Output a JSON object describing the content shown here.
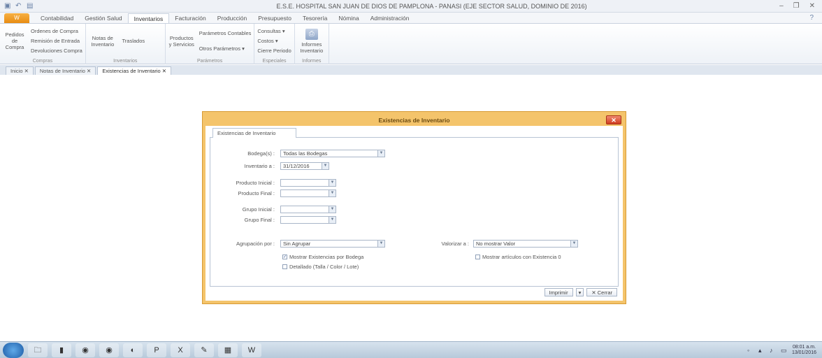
{
  "window": {
    "title": "E.S.E. HOSPITAL SAN JUAN DE DIOS DE PAMPLONA - PANASI (EJE SECTOR SALUD, DOMINIO DE 2016)",
    "qa_icons": [
      "save-icon",
      "undo-icon",
      "app-icon"
    ]
  },
  "ribbon": {
    "app_button": "W",
    "tabs": [
      "Contabilidad",
      "Gestión Salud",
      "Inventarios",
      "Facturación",
      "Producción",
      "Presupuesto",
      "Tesorería",
      "Nómina",
      "Administración"
    ],
    "active_tab": "Inventarios",
    "groups": {
      "compras": {
        "label": "Compras",
        "big": "Pedidos de Compra",
        "items": [
          "Ordenes de Compra",
          "Remisión de Entrada",
          "Devoluciones Compra"
        ]
      },
      "inventario": {
        "label": "Inventarios",
        "big1": "Notas de Inventario",
        "big2": "Traslados"
      },
      "parametros": {
        "label": "Parámetros",
        "big": "Productos y Servicios",
        "items": [
          "Parámetros Contables",
          "Otros Parámetros"
        ]
      },
      "especiales": {
        "label": "Especiales",
        "items": [
          "Consultas",
          "Costos",
          "Cierre Periodo"
        ]
      },
      "informes": {
        "label": "Informes",
        "big": "Informes Inventario"
      }
    }
  },
  "doctabs": [
    {
      "label": "Inicio ✕",
      "active": false
    },
    {
      "label": "Notas de Inventario ✕",
      "active": false
    },
    {
      "label": "Existencias de Inventario ✕",
      "active": true
    }
  ],
  "dialog": {
    "title": "Existencias de Inventario",
    "close": "✕",
    "inner_tab": "Existencias de Inventario",
    "fields": {
      "bodegas_label": "Bodega(s) :",
      "bodegas_value": "Todas las Bodegas",
      "inventario_label": "Inventario a :",
      "inventario_value": "31/12/2016",
      "producto_inicial_label": "Producto Inicial :",
      "producto_inicial_value": "",
      "producto_final_label": "Producto Final :",
      "producto_final_value": "",
      "grupo_inicial_label": "Grupo Inicial :",
      "grupo_inicial_value": "",
      "grupo_final_label": "Grupo Final :",
      "grupo_final_value": "",
      "agrupacion_label": "Agrupación por :",
      "agrupacion_value": "Sin Agrupar",
      "valorizar_label": "Valorizar a :",
      "valorizar_value": "No mostrar Valor"
    },
    "checks": {
      "mostrar_bodega": "Mostrar Existencias por Bodega",
      "mostrar_bodega_checked": true,
      "detallado": "Detallado (Talla / Color / Lote)",
      "detallado_checked": false,
      "mostrar_cero": "Mostrar artículos con Existencia 0",
      "mostrar_cero_checked": false
    },
    "buttons": {
      "imprimir": "Imprimir",
      "cerrar": "Cerrar"
    }
  },
  "taskbar": {
    "apps": [
      "folder-icon",
      "chart-icon",
      "chrome-icon",
      "chrome-icon",
      "firefox-icon",
      "powerpoint-icon",
      "excel-icon",
      "paint-icon",
      "app-icon",
      "word-icon"
    ],
    "clock_time": "08:01 a.m.",
    "clock_date": "13/01/2016"
  }
}
